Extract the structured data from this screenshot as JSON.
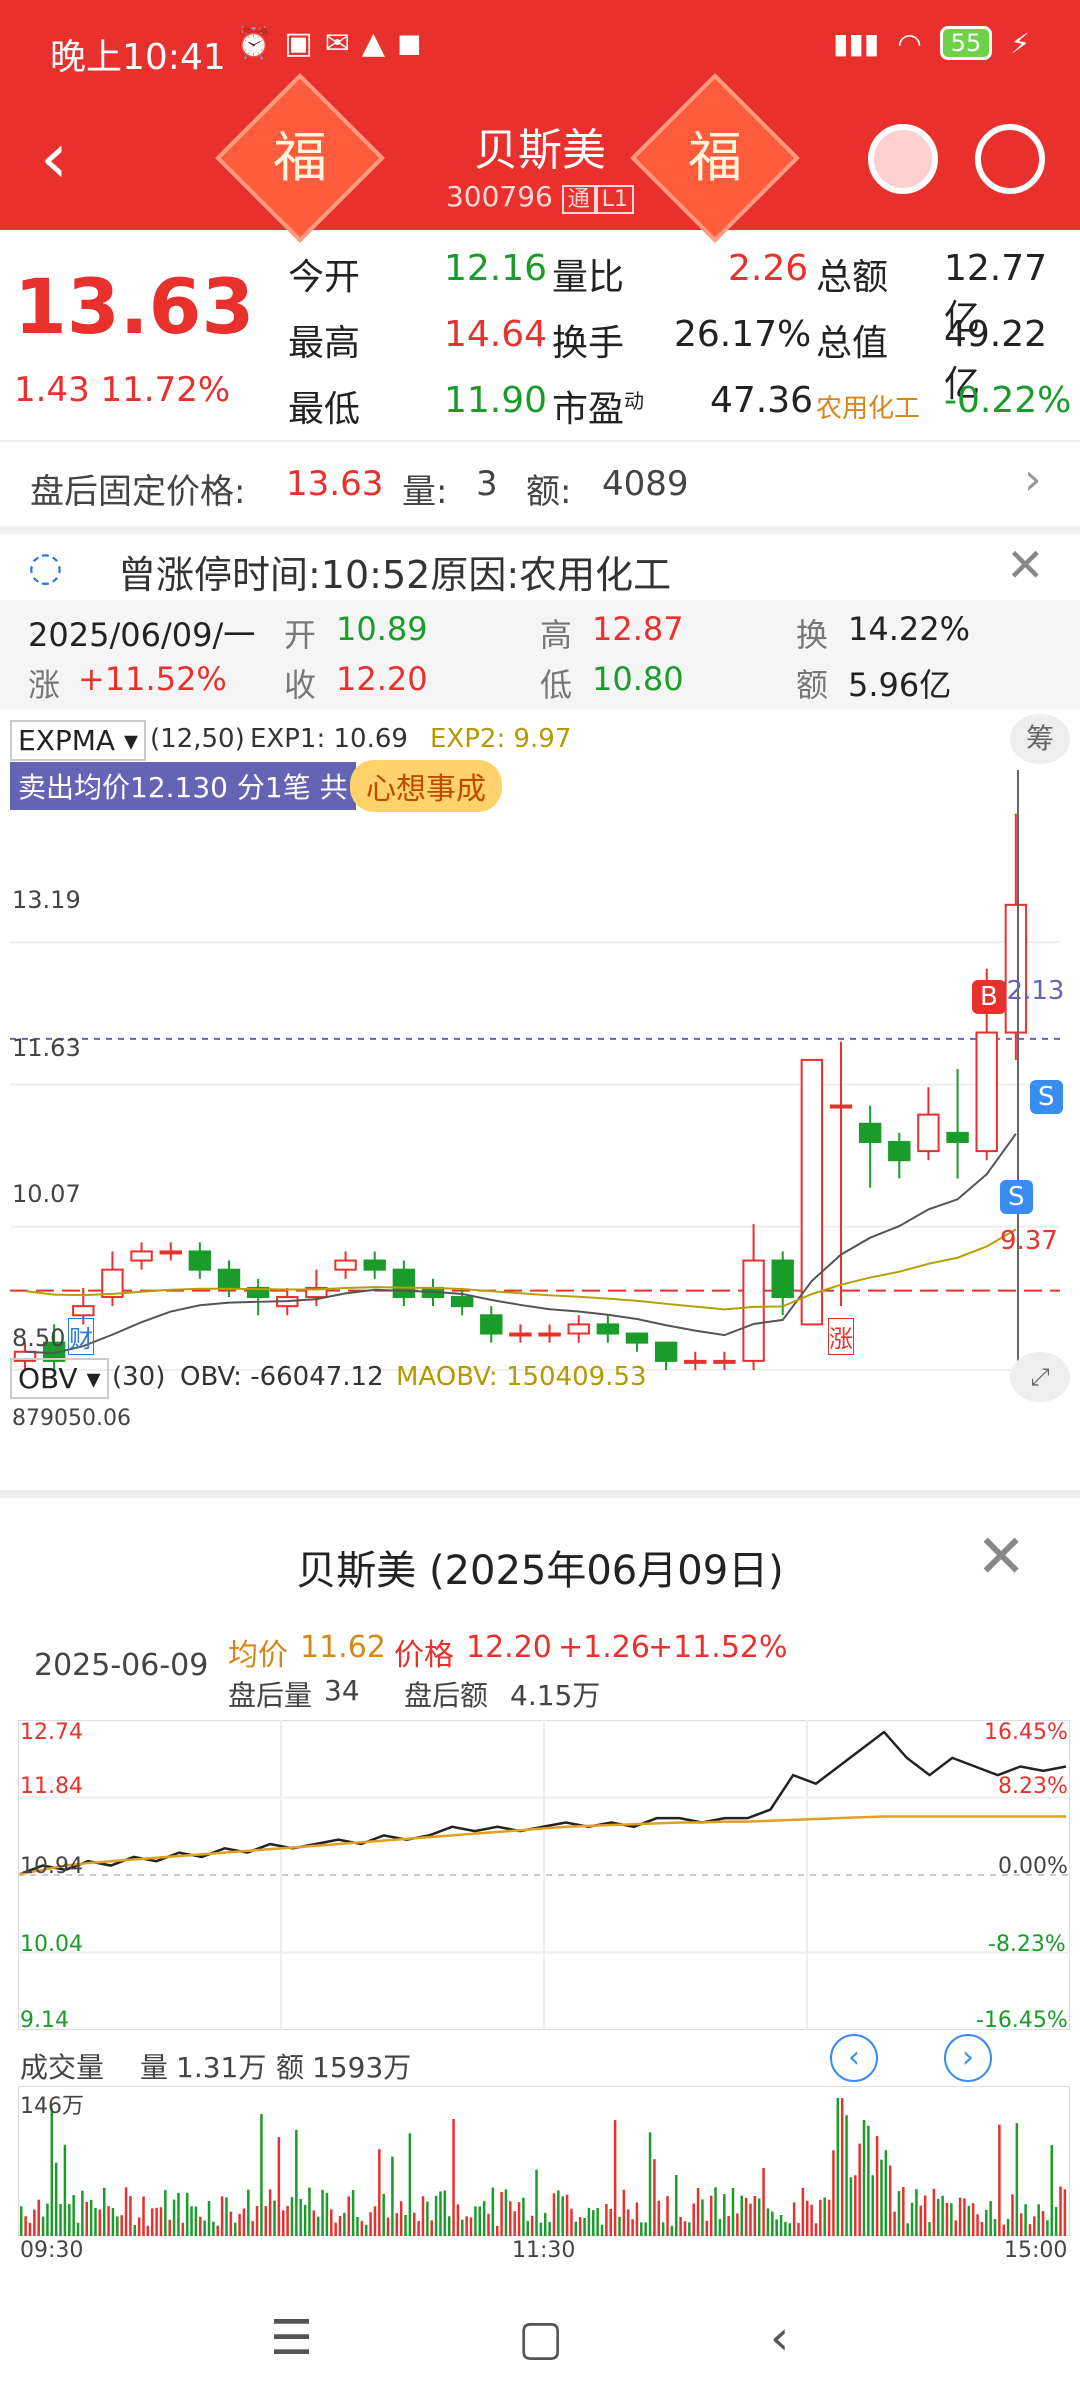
{
  "status": {
    "time": "晚上10:41",
    "battery": "55"
  },
  "header": {
    "name": "贝斯美",
    "code": "300796",
    "badge1": "通",
    "badge2": "L1",
    "fu": "福"
  },
  "quote": {
    "price": "13.63",
    "change": "1.43",
    "change_pct": "11.72%",
    "rows": [
      {
        "l1": "今开",
        "v1": "12.16",
        "l2": "量比",
        "v2": "2.26",
        "l3": "总额",
        "v3": "12.77亿"
      },
      {
        "l1": "最高",
        "v1": "14.64",
        "l2": "换手",
        "v2": "26.17%",
        "l3": "总值",
        "v3": "49.22亿"
      },
      {
        "l1": "最低",
        "v1": "11.90",
        "l2": "市盈",
        "sup": "动",
        "v2": "47.36",
        "l3": "农用化工",
        "v3": "-0.22%"
      }
    ]
  },
  "after_hours": {
    "label": "盘后固定价格:",
    "price": "13.63",
    "vol_label": "量:",
    "vol": "3",
    "amt_label": "额:",
    "amt": "4089"
  },
  "notice": {
    "text": "曾涨停时间:10:52原因:农用化工"
  },
  "day_bar": {
    "date": "2025/06/09/一",
    "open_label": "开",
    "open": "10.89",
    "high_label": "高",
    "high": "12.87",
    "turn_label": "换",
    "turn": "14.22%",
    "pct_label": "涨",
    "pct": "+11.52%",
    "close_label": "收",
    "close": "12.20",
    "low_label": "低",
    "low": "10.80",
    "amt_label": "额",
    "amt": "5.96亿"
  },
  "kchart": {
    "indicator": "EXPMA",
    "params": "(12,50)",
    "exp1": "EXP1: 10.69",
    "exp2": "EXP2: 9.97",
    "chip_btn": "筹",
    "sell_banner": "卖出均价12.130 分1笔 共",
    "sticker": "心想事成",
    "ticks": [
      "13.19",
      "11.63",
      "10.07",
      "8.50"
    ],
    "line_price": "12.13",
    "support_price": "9.37",
    "marker_cai": "财",
    "marker_zhang": "涨",
    "b_label": "B",
    "s_label": "S"
  },
  "obv": {
    "indicator": "OBV",
    "params": "(30)",
    "obv": "OBV: -66047.12",
    "maobv": "MAOBV: 150409.53",
    "top": "879050.06"
  },
  "popup": {
    "title": "贝斯美 (2025年06月09日)",
    "date": "2025-06-09",
    "avg_label": "均价",
    "avg": "11.62",
    "price_label": "价格",
    "price": "12.20",
    "chg": "+1.26",
    "pct": "+11.52%",
    "after_vol_label": "盘后量",
    "after_vol": "34",
    "after_amt_label": "盘后额",
    "after_amt": "4.15万",
    "left_ticks": [
      "12.74",
      "11.84",
      "10.94",
      "10.04",
      "9.14"
    ],
    "right_ticks": [
      "16.45%",
      "8.23%",
      "0.00%",
      "-8.23%",
      "-16.45%"
    ],
    "vol_title": "成交量",
    "vol_label": "量",
    "vol": "1.31万",
    "amt_label": "额",
    "amt": "1593万",
    "vol_top": "146万",
    "time_start": "09:30",
    "time_mid": "11:30",
    "time_end": "15:00"
  },
  "chart_data": [
    {
      "type": "candlestick",
      "title": "EXPMA",
      "ylim": [
        8.5,
        14.64
      ],
      "y_ticks": [
        8.5,
        10.07,
        11.63,
        13.19
      ],
      "candles": [
        {
          "o": 8.6,
          "c": 8.7,
          "h": 8.8,
          "l": 8.5
        },
        {
          "o": 8.8,
          "c": 8.6,
          "h": 9.0,
          "l": 8.5
        },
        {
          "o": 9.1,
          "c": 9.2,
          "h": 9.4,
          "l": 9.0
        },
        {
          "o": 9.3,
          "c": 9.6,
          "h": 9.8,
          "l": 9.2
        },
        {
          "o": 9.7,
          "c": 9.8,
          "h": 9.9,
          "l": 9.6
        },
        {
          "o": 9.8,
          "c": 9.8,
          "h": 9.9,
          "l": 9.7
        },
        {
          "o": 9.8,
          "c": 9.6,
          "h": 9.9,
          "l": 9.5
        },
        {
          "o": 9.6,
          "c": 9.4,
          "h": 9.7,
          "l": 9.3
        },
        {
          "o": 9.4,
          "c": 9.3,
          "h": 9.5,
          "l": 9.1
        },
        {
          "o": 9.2,
          "c": 9.3,
          "h": 9.4,
          "l": 9.1
        },
        {
          "o": 9.3,
          "c": 9.4,
          "h": 9.6,
          "l": 9.2
        },
        {
          "o": 9.6,
          "c": 9.7,
          "h": 9.8,
          "l": 9.5
        },
        {
          "o": 9.7,
          "c": 9.6,
          "h": 9.8,
          "l": 9.5
        },
        {
          "o": 9.6,
          "c": 9.3,
          "h": 9.7,
          "l": 9.2
        },
        {
          "o": 9.4,
          "c": 9.3,
          "h": 9.5,
          "l": 9.2
        },
        {
          "o": 9.3,
          "c": 9.2,
          "h": 9.4,
          "l": 9.1
        },
        {
          "o": 9.1,
          "c": 8.9,
          "h": 9.2,
          "l": 8.8
        },
        {
          "o": 8.9,
          "c": 8.9,
          "h": 9.0,
          "l": 8.8
        },
        {
          "o": 8.9,
          "c": 8.9,
          "h": 9.0,
          "l": 8.8
        },
        {
          "o": 8.9,
          "c": 9.0,
          "h": 9.1,
          "l": 8.8
        },
        {
          "o": 9.0,
          "c": 8.9,
          "h": 9.1,
          "l": 8.8
        },
        {
          "o": 8.9,
          "c": 8.8,
          "h": 8.9,
          "l": 8.7
        },
        {
          "o": 8.8,
          "c": 8.6,
          "h": 8.8,
          "l": 8.5
        },
        {
          "o": 8.6,
          "c": 8.6,
          "h": 8.7,
          "l": 8.5
        },
        {
          "o": 8.6,
          "c": 8.6,
          "h": 8.7,
          "l": 8.5
        },
        {
          "o": 8.6,
          "c": 9.7,
          "h": 10.1,
          "l": 8.5
        },
        {
          "o": 9.7,
          "c": 9.3,
          "h": 9.8,
          "l": 9.1
        },
        {
          "o": 9.0,
          "c": 11.9,
          "h": 11.9,
          "l": 9.0
        },
        {
          "o": 11.4,
          "c": 11.4,
          "h": 12.1,
          "l": 9.2
        },
        {
          "o": 11.2,
          "c": 11.0,
          "h": 11.4,
          "l": 10.5
        },
        {
          "o": 11.0,
          "c": 10.8,
          "h": 11.1,
          "l": 10.6
        },
        {
          "o": 10.9,
          "c": 11.3,
          "h": 11.6,
          "l": 10.8
        },
        {
          "o": 11.1,
          "c": 11.0,
          "h": 11.8,
          "l": 10.6
        },
        {
          "o": 10.9,
          "c": 12.2,
          "h": 12.9,
          "l": 10.8
        },
        {
          "o": 12.2,
          "c": 13.6,
          "h": 14.6,
          "l": 11.9
        }
      ]
    },
    {
      "type": "line",
      "title": "贝斯美 (2025年06月09日)",
      "ylim": [
        9.14,
        12.74
      ],
      "y_ticks": [
        9.14,
        10.04,
        10.94,
        11.84,
        12.74
      ],
      "series": [
        {
          "values": [
            10.95,
            11.05,
            11.0,
            11.1,
            11.05,
            11.15,
            11.1,
            11.2,
            11.15,
            11.25,
            11.2,
            11.3,
            11.25,
            11.3,
            11.35,
            11.3,
            11.4,
            11.35,
            11.4,
            11.5,
            11.45,
            11.5,
            11.45,
            11.5,
            11.55,
            11.5,
            11.55,
            11.5,
            11.6,
            11.6,
            11.55,
            11.6,
            11.6,
            11.7,
            12.1,
            12.0,
            12.2,
            12.4,
            12.6,
            12.3,
            12.1,
            12.3,
            12.2,
            12.1,
            12.2,
            12.15,
            12.2
          ]
        },
        {
          "values": [
            10.95,
            11.0,
            11.05,
            11.08,
            11.1,
            11.12,
            11.14,
            11.16,
            11.18,
            11.2,
            11.22,
            11.24,
            11.26,
            11.28,
            11.3,
            11.32,
            11.34,
            11.36,
            11.38,
            11.4,
            11.42,
            11.44,
            11.46,
            11.48,
            11.5,
            11.51,
            11.52,
            11.53,
            11.54,
            11.55,
            11.55,
            11.56,
            11.56,
            11.57,
            11.58,
            11.59,
            11.6,
            11.61,
            11.62,
            11.62,
            11.62,
            11.62,
            11.62,
            11.62,
            11.62,
            11.62,
            11.62
          ]
        }
      ]
    }
  ]
}
